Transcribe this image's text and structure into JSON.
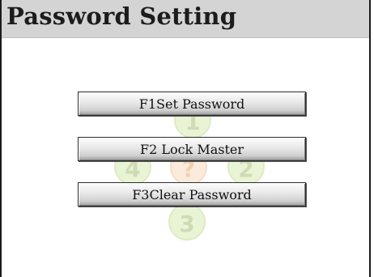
{
  "window": {
    "title": "Password Setting"
  },
  "buttons": {
    "set_password": "F1Set Password",
    "lock_master": "F2 Lock Master",
    "clear_password": "F3Clear Password"
  },
  "watermark": {
    "icon": "numbered-circles-logo",
    "digits": [
      "1",
      "2",
      "3",
      "4",
      "?"
    ],
    "colors": {
      "green": "#c9e39a",
      "orange": "#f5c9a0"
    }
  }
}
